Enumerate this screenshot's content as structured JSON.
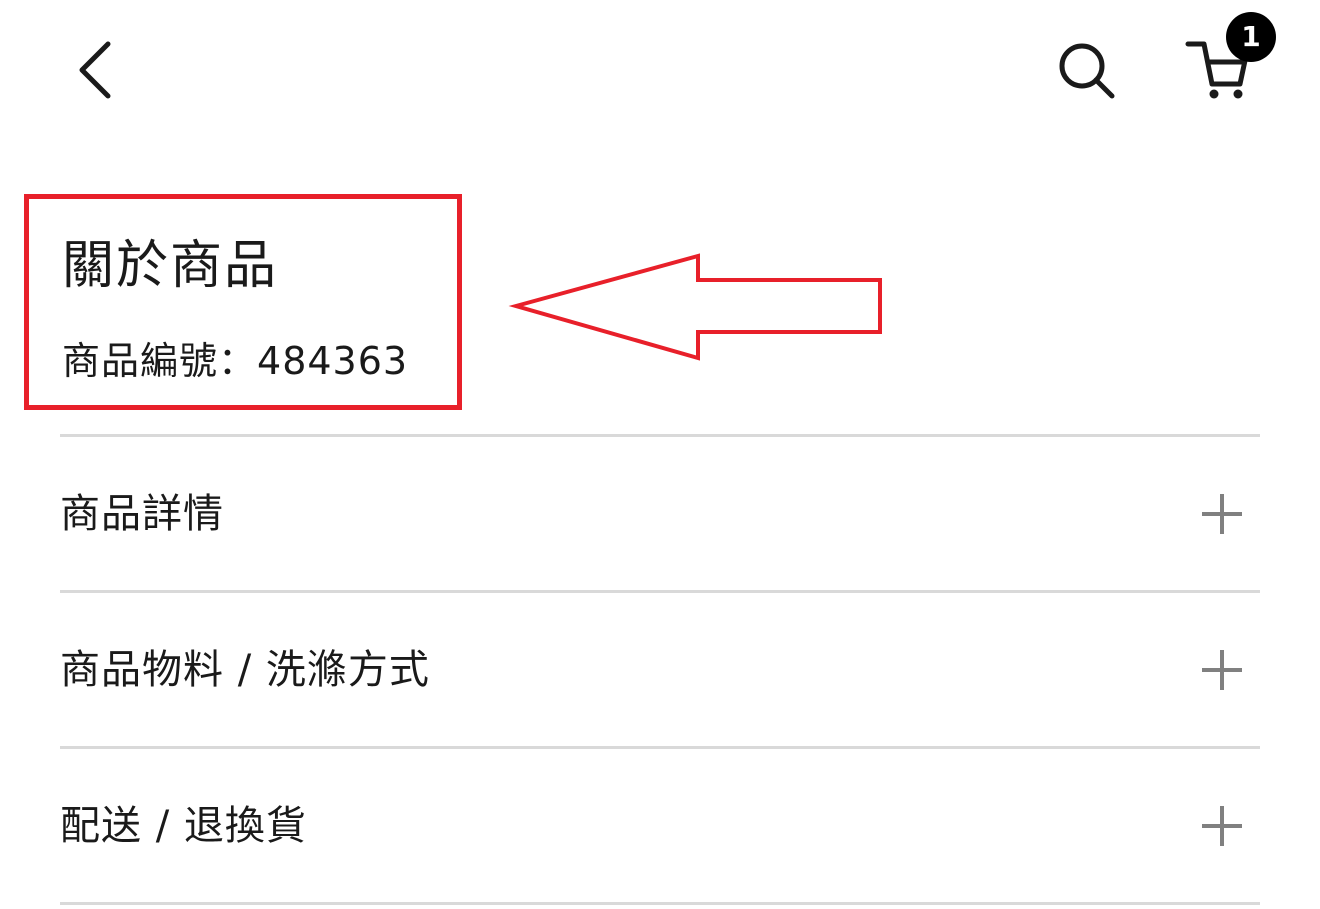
{
  "header": {
    "back_icon": "chevron-left-icon",
    "search_icon": "search-icon",
    "cart_icon": "shopping-cart-icon",
    "cart_count": "1"
  },
  "about": {
    "title": "關於商品",
    "code_label": "商品編號",
    "code_separator": "：",
    "code_value": "484363"
  },
  "accordion": {
    "items": [
      {
        "label": "商品詳情",
        "icon": "plus-icon"
      },
      {
        "label": "商品物料 / 洗滌方式",
        "icon": "plus-icon"
      },
      {
        "label": "配送 / 退換貨",
        "icon": "plus-icon"
      }
    ]
  },
  "colors": {
    "highlight": "#e8202a",
    "divider": "#d9d9d9",
    "icon_gray": "#808080",
    "badge": "#000000"
  }
}
